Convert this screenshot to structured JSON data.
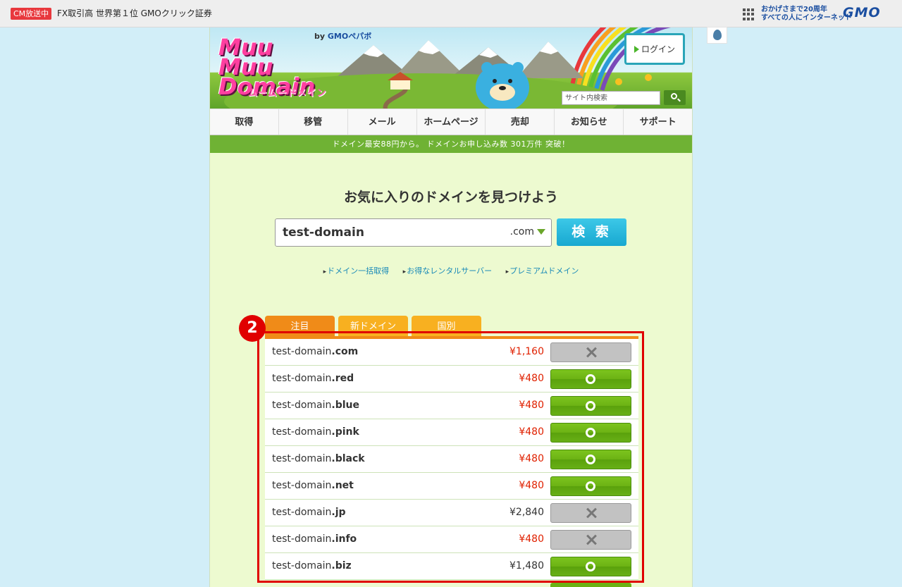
{
  "topbar": {
    "cm_badge": "CM放送中",
    "ad_text": "FX取引高 世界第１位 GMOクリック証券",
    "gmo_tagline_1": "おかげさまで20周年",
    "gmo_tagline_2": "すべての人にインターネット",
    "gmo_logo": "GMO"
  },
  "header": {
    "by_text": "by",
    "by_brand": "GMOペパボ",
    "logo_line1": "Muu",
    "logo_line2": "Muu",
    "logo_line3": "Domain",
    "logo_kana": "ムームードメイン",
    "login_label": "ログイン",
    "site_search_placeholder": "サイト内検索"
  },
  "nav": {
    "items": [
      "取得",
      "移管",
      "メール",
      "ホームページ",
      "売却",
      "お知らせ",
      "サポート"
    ]
  },
  "banner": "ドメイン最安88円から。 ドメインお申し込み数  301万件 突破！",
  "search": {
    "headline": "お気に入りのドメインを見つけよう",
    "value": "test-domain",
    "tld": ".com",
    "button": "検 索"
  },
  "links": [
    "ドメイン一括取得",
    "お得なレンタルサーバー",
    "プレミアムドメイン"
  ],
  "tabs": [
    "注目",
    "新ドメイン",
    "国別"
  ],
  "results": [
    {
      "name": "test-domain",
      "tld": ".com",
      "price": "¥1,160",
      "price_highlight": true,
      "available": false
    },
    {
      "name": "test-domain",
      "tld": ".red",
      "price": "¥480",
      "price_highlight": true,
      "available": true
    },
    {
      "name": "test-domain",
      "tld": ".blue",
      "price": "¥480",
      "price_highlight": true,
      "available": true
    },
    {
      "name": "test-domain",
      "tld": ".pink",
      "price": "¥480",
      "price_highlight": true,
      "available": true
    },
    {
      "name": "test-domain",
      "tld": ".black",
      "price": "¥480",
      "price_highlight": true,
      "available": true
    },
    {
      "name": "test-domain",
      "tld": ".net",
      "price": "¥480",
      "price_highlight": true,
      "available": true
    },
    {
      "name": "test-domain",
      "tld": ".jp",
      "price": "¥2,840",
      "price_highlight": false,
      "available": false
    },
    {
      "name": "test-domain",
      "tld": ".info",
      "price": "¥480",
      "price_highlight": true,
      "available": false
    },
    {
      "name": "test-domain",
      "tld": ".biz",
      "price": "¥1,480",
      "price_highlight": false,
      "available": true
    }
  ],
  "annotation": {
    "step_number": "2"
  },
  "colors": {
    "accent_green": "#6fb234",
    "tab_orange": "#f08b18",
    "price_red": "#e02000",
    "search_button": "#18a8d0",
    "annotation_red": "#e00000"
  }
}
